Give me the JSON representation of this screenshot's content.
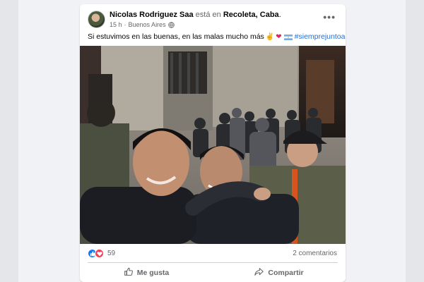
{
  "post": {
    "author": "Nicolas Rodriguez Saa",
    "connector": "está en",
    "location": "Recoleta, Caba",
    "timestamp": "15 h",
    "separator": "·",
    "place": "Buenos Aires",
    "more_label": "•••",
    "text": "Si estuvimos en las buenas, en las malas mucho más",
    "emojis": [
      "✌",
      "❤"
    ],
    "hashtag": "#siemprejuntoacristina",
    "image_icon": "photo",
    "privacy_icon": "globe-icon"
  },
  "stats": {
    "reactions_count": "59",
    "comments": "2 comentarios",
    "reaction_icons": [
      "like-icon",
      "love-icon"
    ]
  },
  "actions": {
    "like_label": "Me gusta",
    "share_label": "Compartir"
  },
  "colors": {
    "accent": "#216fdb",
    "like": "#1877f2",
    "love": "#f33e58",
    "secondary_text": "#65676b"
  }
}
